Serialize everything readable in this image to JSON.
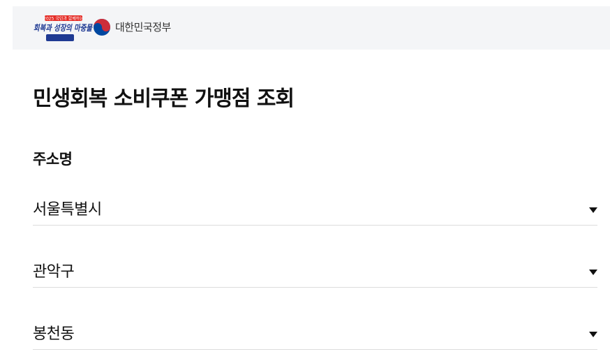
{
  "header": {
    "campaign_logo_text": "회복과 성장의 마중물",
    "campaign_logo_subtext": "2025 국민과 함께하는",
    "gov_name": "대한민국정부"
  },
  "page_title": "민생회복 소비쿠폰 가맹점 조회",
  "address": {
    "label": "주소명",
    "selects": [
      {
        "value": "서울특별시",
        "icon": "triangle-down-icon"
      },
      {
        "value": "관악구",
        "icon": "triangle-down-icon"
      },
      {
        "value": "봉천동",
        "icon": "triangle-down-icon"
      }
    ]
  },
  "colors": {
    "header_bg": "#f4f5f7",
    "logo_red": "#e52d27",
    "logo_navy": "#1f3a93",
    "emblem_red": "#cd2e3a",
    "emblem_blue": "#0047a0",
    "divider": "#dcdcdc",
    "text": "#111111"
  }
}
